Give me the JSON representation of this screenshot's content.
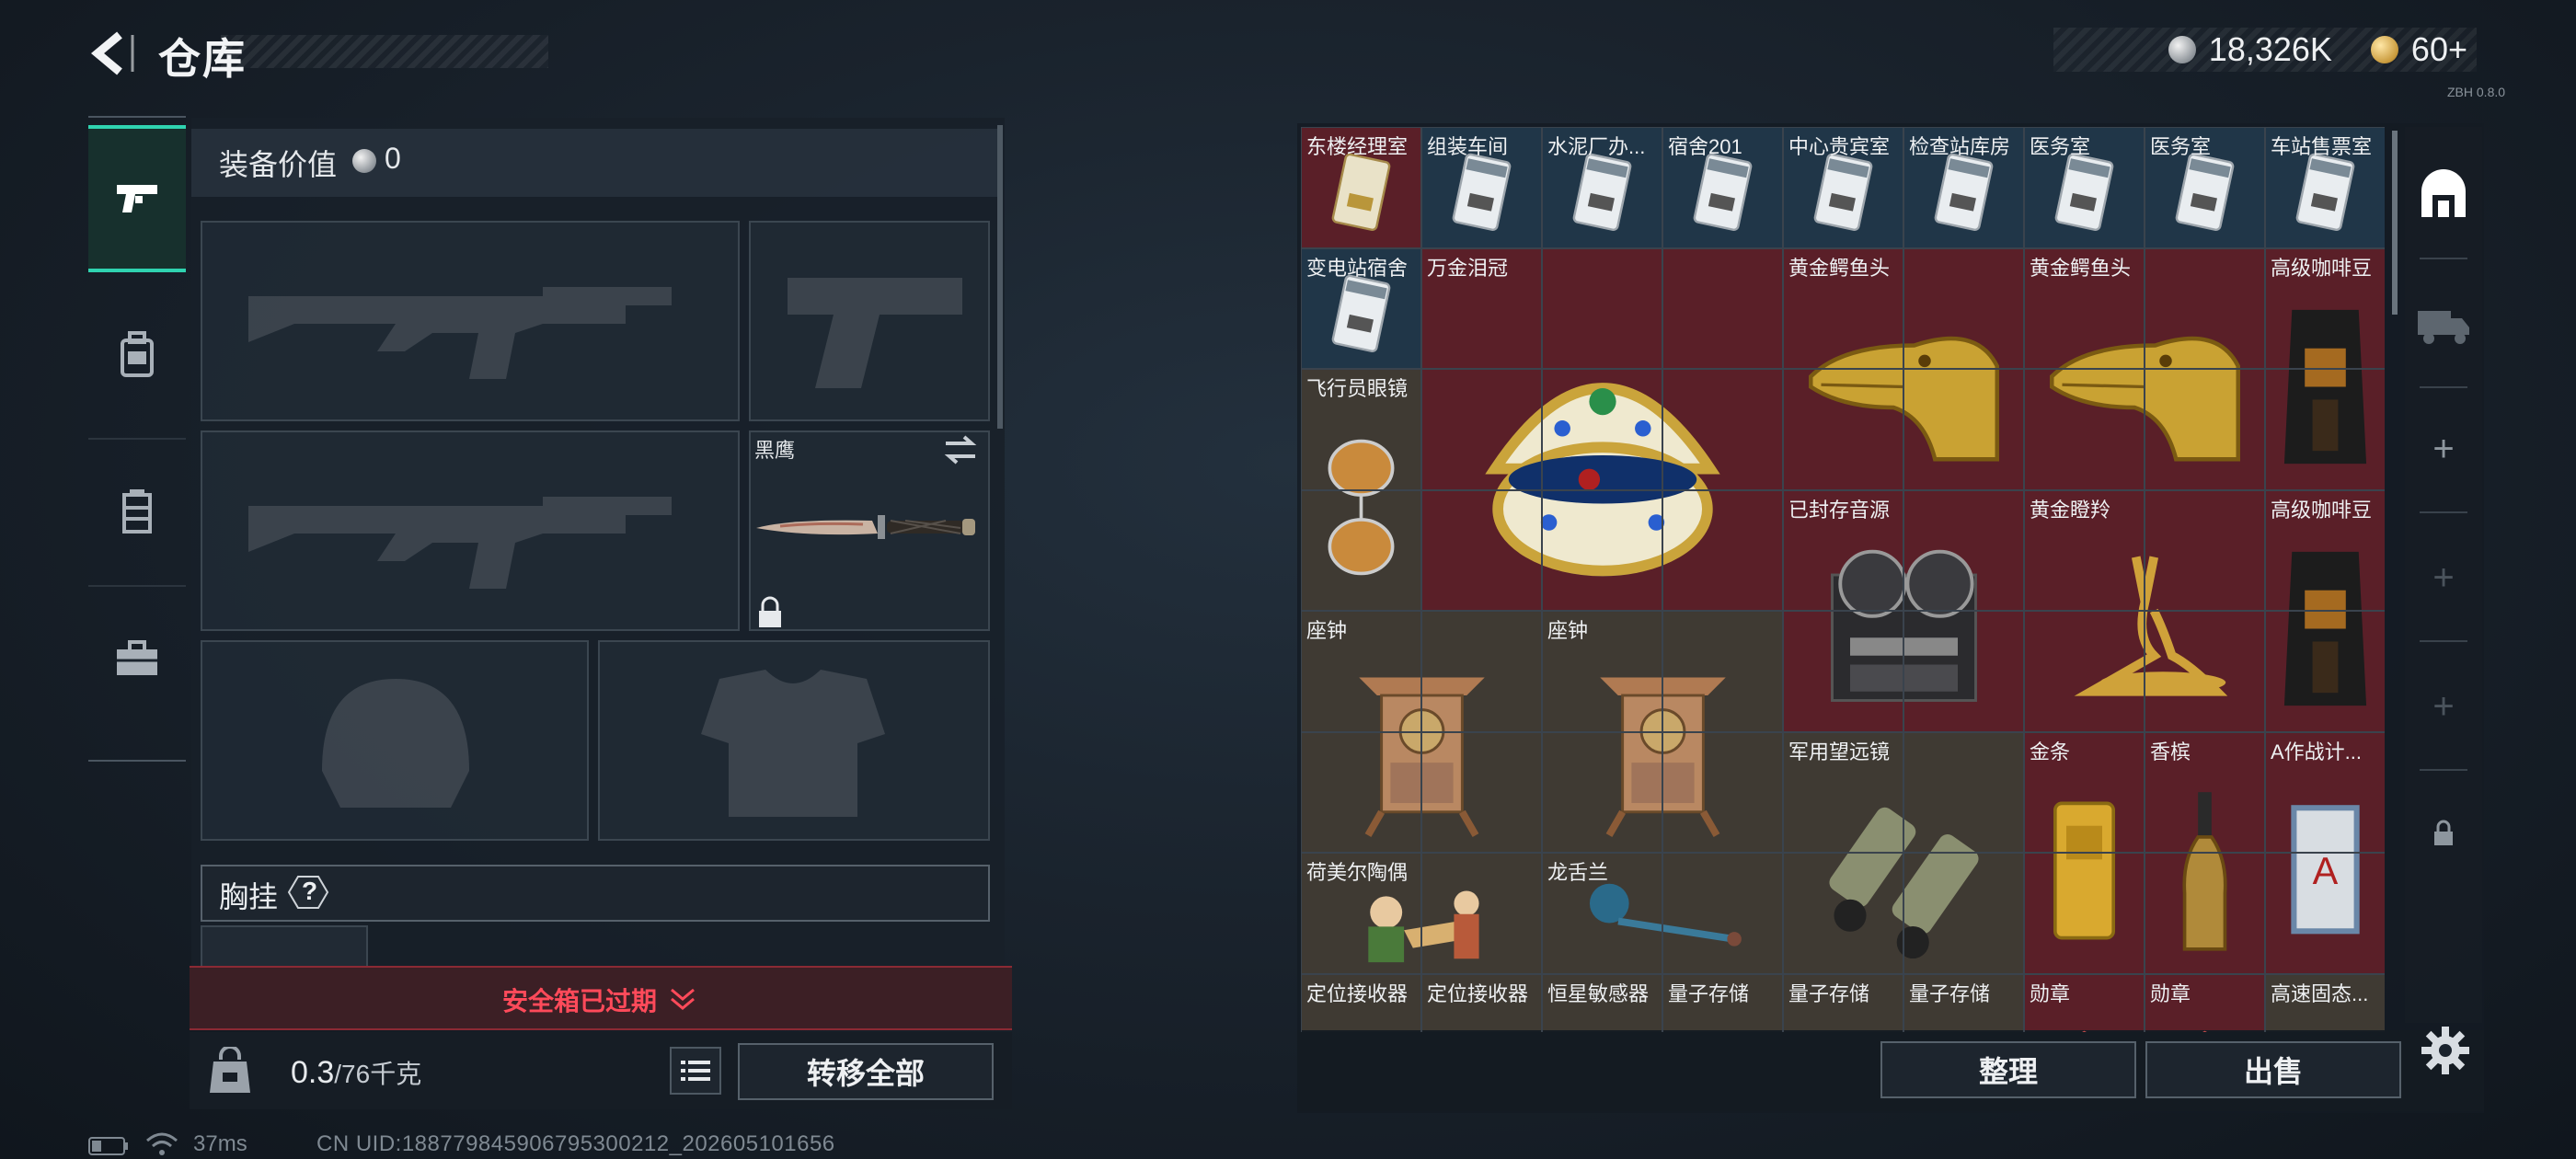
{
  "header": {
    "title": "仓库"
  },
  "currency": {
    "silver": "18,326K",
    "gold": "60+",
    "version_text": "ZBH 0.8.0"
  },
  "categories": [
    {
      "icon": "pistol-icon",
      "active": true
    },
    {
      "icon": "backpack-icon",
      "active": false
    },
    {
      "icon": "vest-icon",
      "active": false
    },
    {
      "icon": "toolbox-icon",
      "active": false
    }
  ],
  "equipment": {
    "value_label": "装备价值",
    "value": "0",
    "knife_name": "黑鹰",
    "chest_rig_label": "胸挂",
    "chest_rig_help": "?"
  },
  "safe_box": {
    "expired_text": "安全箱已过期"
  },
  "capacity": {
    "current": "0.3",
    "max": "/76千克"
  },
  "buttons": {
    "transfer_all": "转移全部",
    "sort": "整理",
    "sell": "出售"
  },
  "status": {
    "ping": "37ms",
    "uid": "CN UID:1887798459067953002​12_202605101656"
  },
  "colors": {
    "accent": "#2fd3b0",
    "warning": "#ff4a5a",
    "rare_bg": "#5a1f28",
    "common_bg": "#203648"
  },
  "grid_items": [
    {
      "name": "东楼经理室",
      "kind": "keycard-red"
    },
    {
      "name": "组装车间",
      "kind": "keycard"
    },
    {
      "name": "水泥厂办...",
      "kind": "keycard"
    },
    {
      "name": "宿舍201",
      "kind": "keycard"
    },
    {
      "name": "中心贵宾室",
      "kind": "keycard"
    },
    {
      "name": "检查站库房",
      "kind": "keycard"
    },
    {
      "name": "医务室",
      "kind": "keycard"
    },
    {
      "name": "医务室",
      "kind": "keycard"
    },
    {
      "name": "车站售票室",
      "kind": "keycard"
    },
    {
      "name": "变电站宿舍",
      "kind": "keycard"
    },
    {
      "name": "万金泪冠",
      "kind": "jeweled-egg"
    },
    {
      "name": "黄金鳄鱼头",
      "kind": "croc-head"
    },
    {
      "name": "黄金鳄鱼头",
      "kind": "croc-head"
    },
    {
      "name": "高级咖啡豆",
      "kind": "coffee"
    },
    {
      "name": "飞行员眼镜",
      "kind": "sunglasses"
    },
    {
      "name": "已封存音源",
      "kind": "reel-recorder"
    },
    {
      "name": "黄金瞪羚",
      "kind": "gazelle"
    },
    {
      "name": "高级咖啡豆",
      "kind": "coffee"
    },
    {
      "name": "座钟",
      "kind": "clock"
    },
    {
      "name": "座钟",
      "kind": "clock"
    },
    {
      "name": "军用望远镜",
      "kind": "binoculars"
    },
    {
      "name": "金条",
      "kind": "gold-bar"
    },
    {
      "name": "香槟",
      "kind": "champagne"
    },
    {
      "name": "A作战计...",
      "kind": "book"
    },
    {
      "name": "荷美尔陶偶",
      "kind": "figurine"
    },
    {
      "name": "龙舌兰",
      "kind": "mace"
    },
    {
      "name": "定位接收器",
      "kind": "device"
    },
    {
      "name": "定位接收器",
      "kind": "device"
    },
    {
      "name": "恒星敏感器",
      "kind": "device"
    },
    {
      "name": "量子存储",
      "kind": "device"
    },
    {
      "name": "量子存储",
      "kind": "device"
    },
    {
      "name": "量子存储",
      "kind": "device"
    },
    {
      "name": "勋章",
      "kind": "medal"
    },
    {
      "name": "勋章",
      "kind": "medal"
    },
    {
      "name": "高速固态...",
      "kind": "device"
    }
  ]
}
